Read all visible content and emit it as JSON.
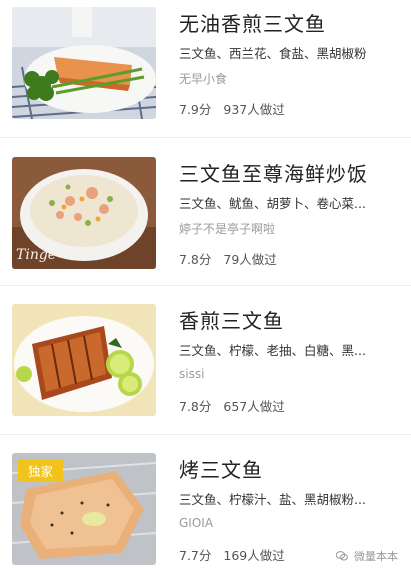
{
  "recipes": [
    {
      "title": "无油香煎三文鱼",
      "ingredients": "三文鱼、西兰花、食盐、黑胡椒粉",
      "author": "无早小食",
      "score": "7.9分",
      "made": "937人做过",
      "badge": ""
    },
    {
      "title": "三文鱼至尊海鲜炒饭",
      "ingredients": "三文鱼、鱿鱼、胡萝卜、卷心菜...",
      "author": "婷子不是亭子啊啦",
      "score": "7.8分",
      "made": "79人做过",
      "badge": "",
      "image_text": "Tinge"
    },
    {
      "title": "香煎三文鱼",
      "ingredients": "三文鱼、柠檬、老抽、白糖、黑...",
      "author": "sissi",
      "score": "7.8分",
      "made": "657人做过",
      "badge": ""
    },
    {
      "title": "烤三文鱼",
      "ingredients": "三文鱼、柠檬汁、盐、黑胡椒粉...",
      "author": "GIOIA",
      "score": "7.7分",
      "made": "169人做过",
      "badge": "独家"
    }
  ],
  "watermark": "微量本本",
  "colors": {
    "badge": "#f2c31a",
    "title": "#222222",
    "muted": "#9a9a9a"
  }
}
